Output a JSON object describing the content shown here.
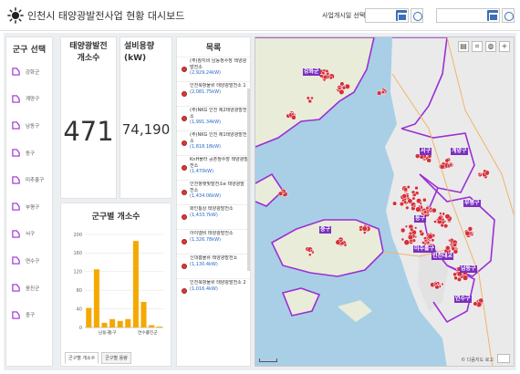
{
  "header": {
    "title": "인천시 태양광발전사업 현황 대시보드",
    "date_label": "사업개시일 선택",
    "start_date": "",
    "end_date": ""
  },
  "districts": {
    "title": "군구 선택",
    "items": [
      "강화군",
      "계양구",
      "남동구",
      "동구",
      "미추홀구",
      "부평구",
      "서구",
      "연수구",
      "옹진군",
      "중구"
    ]
  },
  "stats": {
    "count_title": "태양광발전 개소수",
    "count_value": "471",
    "capacity_title": "설비용량(kW)",
    "capacity_value": "74,190"
  },
  "plant_list": {
    "title": "목록",
    "items": [
      {
        "name": "(주)참지비 남동정수장 태양광발전소",
        "capacity": "(2,929.24kW)"
      },
      {
        "name": "인천북항물류 태양광발전소 1",
        "capacity": "(2,081.75kW)"
      },
      {
        "name": "(주)NKG 인천 제2태양광발전소",
        "capacity": "(1,991.34kW)"
      },
      {
        "name": "(주)NKG 인천 제1태양광발전소",
        "capacity": "(1,818.18kW)"
      },
      {
        "name": "KnH플라 공촌정수장 태양광발전소",
        "capacity": "(1,470kW)"
      },
      {
        "name": "인천항햇빛발전소e 태양광발전소",
        "capacity": "(1,434.06kW)"
      },
      {
        "name": "화인통상 태양광발전소",
        "capacity": "(1,433.7kW)"
      },
      {
        "name": "아이엘비 태양광발전소",
        "capacity": "(1,326.78kW)"
      },
      {
        "name": "신대흥물류 태양광발전소",
        "capacity": "(1,130.4kW)"
      },
      {
        "name": "인천북항물류 태양광발전소 2",
        "capacity": "(1,016.4kW)"
      }
    ]
  },
  "chart": {
    "title": "군구별 개소수",
    "tabs": [
      "군구별 개소수",
      "군구별 용량"
    ]
  },
  "chart_data": {
    "type": "bar",
    "categories": [
      "강화군",
      "계양구",
      "남동구",
      "동구",
      "미추홀구",
      "부평구",
      "서구",
      "연수구",
      "옹진군",
      "중구"
    ],
    "tick_labels": [
      "남동구",
      "동구",
      "옹진군",
      "연수구"
    ],
    "values": [
      42,
      125,
      10,
      18,
      14,
      18,
      186,
      55,
      5,
      2
    ],
    "yticks": [
      0,
      40,
      80,
      120,
      160,
      200
    ],
    "ylim": [
      0,
      200
    ],
    "color": "#f5a800"
  },
  "map": {
    "labels": [
      "강화군",
      "계양구",
      "부평구",
      "미추홀구",
      "남동구",
      "연수구",
      "인천대교",
      "중구",
      "서구",
      "동구"
    ],
    "attribution": "© 다음지도 로고",
    "polygon_color": "#9b2fd4",
    "marker_color": "#d4303a"
  }
}
